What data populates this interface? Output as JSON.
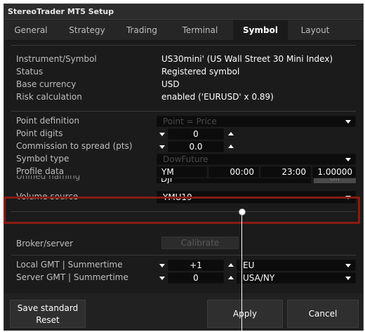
{
  "window": {
    "title": "StereoTrader MT5 Setup"
  },
  "tabs": [
    {
      "label": "General"
    },
    {
      "label": "Strategy"
    },
    {
      "label": "Trading"
    },
    {
      "label": "Terminal"
    },
    {
      "label": "Symbol",
      "active": true
    },
    {
      "label": "Layout"
    }
  ],
  "info": {
    "instrument_label": "Instrument/Symbol",
    "instrument_value": "US30mini' (US Wall Street 30 Mini Index)",
    "status_label": "Status",
    "status_value": "Registered symbol",
    "base_currency_label": "Base currency",
    "base_currency_value": "USD",
    "risk_label": "Risk calculation",
    "risk_value": "enabled ('EURUSD' x 0.89)"
  },
  "settings": {
    "point_definition_label": "Point definition",
    "point_definition_value": "Point = Price",
    "point_digits_label": "Point digits",
    "point_digits_value": "0",
    "commission_label": "Commission to spread (pts)",
    "commission_value": "0.0",
    "symbol_type_label": "Symbol type",
    "symbol_type_value": "DowFuture",
    "profile_label": "Profile data",
    "profile_symbol": "YM",
    "profile_start": "00:00",
    "profile_end": "23:00",
    "profile_factor": "1.00000",
    "unified_label": "Unified naming",
    "unified_value": "DJI",
    "unified_toggle": "Off",
    "volume_source_label": "Volume source",
    "volume_source_value": "YMU19"
  },
  "broker": {
    "label": "Broker/server",
    "calibrate_label": "Calibrate"
  },
  "gmt": {
    "local_label": "Local GMT | Summertime",
    "local_offset": "+1",
    "local_summertime": "EU",
    "server_label": "Server GMT | Summertime",
    "server_offset": "0",
    "server_summertime": "USA/NY"
  },
  "footer": {
    "save_standard": "Save standard",
    "reset": "Reset",
    "apply": "Apply",
    "cancel": "Cancel"
  },
  "colors": {
    "highlight": "#8a1b12",
    "background": "#1b1b1b"
  }
}
